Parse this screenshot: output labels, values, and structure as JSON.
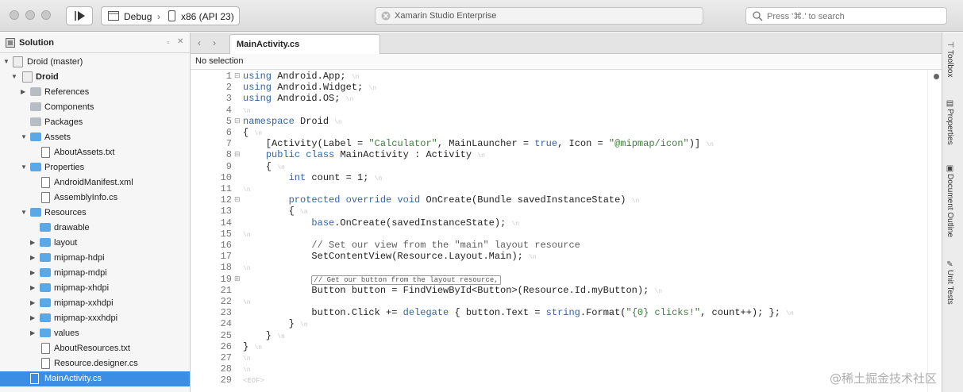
{
  "titlebar": {
    "run_config": "Debug",
    "device": "x86 (API 23)",
    "status_text": "Xamarin Studio Enterprise",
    "search_placeholder": "Press '⌘.' to search"
  },
  "solution": {
    "title": "Solution",
    "items": [
      {
        "label": "Droid (master)",
        "kind": "solution",
        "expanded": true
      },
      {
        "label": "Droid",
        "kind": "project",
        "expanded": true
      },
      {
        "label": "References",
        "kind": "gray-folder",
        "expanded": false
      },
      {
        "label": "Components",
        "kind": "gray-folder"
      },
      {
        "label": "Packages",
        "kind": "gray-folder"
      },
      {
        "label": "Assets",
        "kind": "folder",
        "expanded": true
      },
      {
        "label": "AboutAssets.txt",
        "kind": "file"
      },
      {
        "label": "Properties",
        "kind": "folder",
        "expanded": true
      },
      {
        "label": "AndroidManifest.xml",
        "kind": "file"
      },
      {
        "label": "AssemblyInfo.cs",
        "kind": "file"
      },
      {
        "label": "Resources",
        "kind": "folder",
        "expanded": true
      },
      {
        "label": "drawable",
        "kind": "folder"
      },
      {
        "label": "layout",
        "kind": "folder",
        "expanded": false
      },
      {
        "label": "mipmap-hdpi",
        "kind": "folder",
        "expanded": false
      },
      {
        "label": "mipmap-mdpi",
        "kind": "folder",
        "expanded": false
      },
      {
        "label": "mipmap-xhdpi",
        "kind": "folder",
        "expanded": false
      },
      {
        "label": "mipmap-xxhdpi",
        "kind": "folder",
        "expanded": false
      },
      {
        "label": "mipmap-xxxhdpi",
        "kind": "folder",
        "expanded": false
      },
      {
        "label": "values",
        "kind": "folder",
        "expanded": false
      },
      {
        "label": "AboutResources.txt",
        "kind": "file"
      },
      {
        "label": "Resource.designer.cs",
        "kind": "file"
      },
      {
        "label": "MainActivity.cs",
        "kind": "file",
        "selected": true
      }
    ]
  },
  "editor": {
    "tab_label": "MainActivity.cs",
    "selection_text": "No selection",
    "line_numbers": [
      "1",
      "2",
      "3",
      "4",
      "5",
      "6",
      "7",
      "8",
      "9",
      "10",
      "11",
      "12",
      "13",
      "14",
      "15",
      "16",
      "17",
      "18",
      "19",
      "21",
      "22",
      "23",
      "24",
      "25",
      "26",
      "27",
      "28",
      "29"
    ],
    "lines": [
      "using Android.App;",
      "using Android.Widget;",
      "using Android.OS;",
      "",
      "namespace Droid",
      "{",
      "    [Activity(Label = \"Calculator\", MainLauncher = true, Icon = \"@mipmap/icon\")]",
      "    public class MainActivity : Activity",
      "    {",
      "        int count = 1;",
      "",
      "        protected override void OnCreate(Bundle savedInstanceState)",
      "        {",
      "            base.OnCreate(savedInstanceState);",
      "",
      "            // Set our view from the \"main\" layout resource",
      "            SetContentView(Resource.Layout.Main);",
      "",
      "            // Get our button from the layout resource,",
      "            Button button = FindViewById<Button>(Resource.Id.myButton);",
      "",
      "            button.Click += delegate { button.Text = string.Format(\"{0} clicks!\", count++); };",
      "        }",
      "    }",
      "}",
      "",
      "",
      "<EOF>"
    ]
  },
  "right_dock": {
    "tabs": [
      "Toolbox",
      "Properties",
      "Document Outline",
      "Unit Tests"
    ]
  },
  "watermark": "@稀土掘金技术社区"
}
